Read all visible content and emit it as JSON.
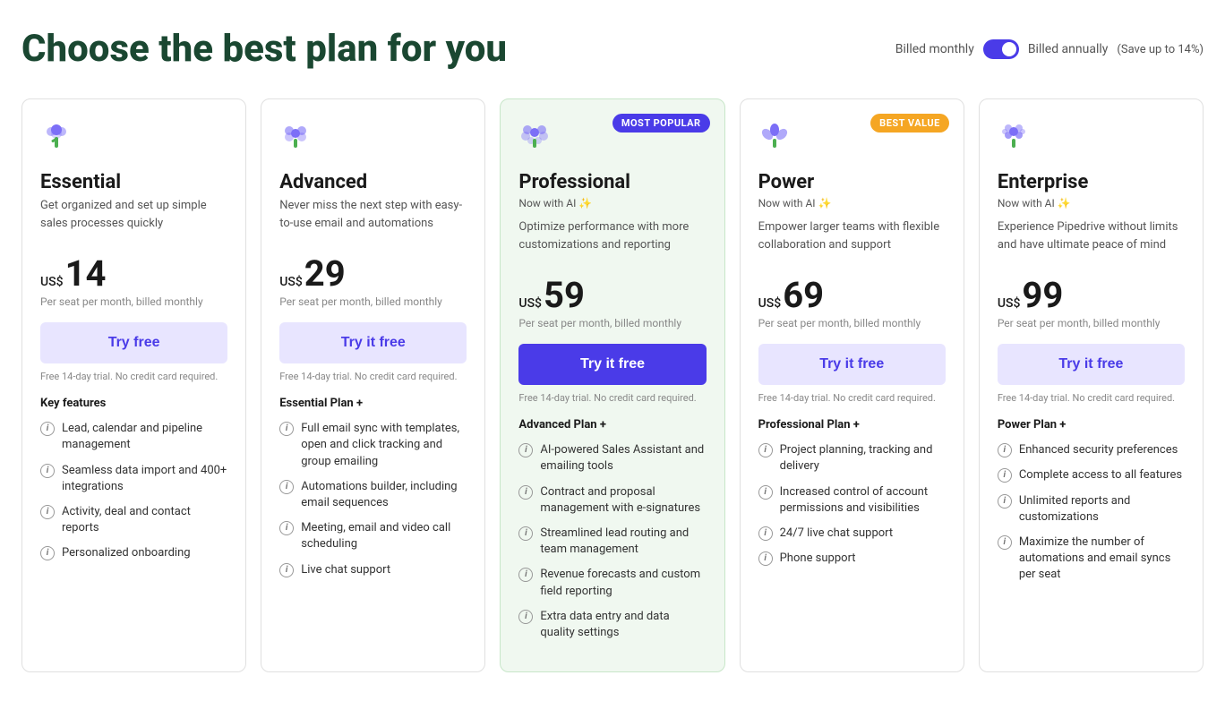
{
  "header": {
    "title": "Choose the best plan for you",
    "billing": {
      "monthly_label": "Billed monthly",
      "annually_label": "Billed annually",
      "save_label": "(Save up to 14%)",
      "toggle_state": "annually"
    }
  },
  "plans": [
    {
      "id": "essential",
      "name": "Essential",
      "badge": null,
      "highlighted": false,
      "ai": false,
      "description": "Get organized and set up simple sales processes quickly",
      "currency": "US$",
      "price": "14",
      "period": "Per seat per month, billed monthly",
      "btn_label": "Try free",
      "btn_style": "default",
      "trial_note": "Free 14-day trial. No credit card required.",
      "features_title": "Key features",
      "features": [
        "Lead, calendar and pipeline management",
        "Seamless data import and 400+ integrations",
        "Activity, deal and contact reports",
        "Personalized onboarding"
      ]
    },
    {
      "id": "advanced",
      "name": "Advanced",
      "badge": null,
      "highlighted": false,
      "ai": false,
      "description": "Never miss the next step with easy-to-use email and automations",
      "currency": "US$",
      "price": "29",
      "period": "Per seat per month, billed monthly",
      "btn_label": "Try it free",
      "btn_style": "default",
      "trial_note": "Free 14-day trial. No credit card required.",
      "features_title": "Essential Plan +",
      "features": [
        "Full email sync with templates, open and click tracking and group emailing",
        "Automations builder, including email sequences",
        "Meeting, email and video call scheduling",
        "Live chat support"
      ]
    },
    {
      "id": "professional",
      "name": "Professional",
      "badge": "MOST POPULAR",
      "badge_style": "popular",
      "highlighted": true,
      "ai": true,
      "ai_label": "Now with AI ✨",
      "description": "Optimize performance with more customizations and reporting",
      "currency": "US$",
      "price": "59",
      "period": "Per seat per month, billed monthly",
      "btn_label": "Try it free",
      "btn_style": "primary",
      "trial_note": "Free 14-day trial. No credit card required.",
      "features_title": "Advanced Plan +",
      "features": [
        "AI-powered Sales Assistant and emailing tools",
        "Contract and proposal management with e-signatures",
        "Streamlined lead routing and team management",
        "Revenue forecasts and custom field reporting",
        "Extra data entry and data quality settings"
      ]
    },
    {
      "id": "power",
      "name": "Power",
      "badge": "BEST VALUE",
      "badge_style": "value",
      "highlighted": false,
      "ai": true,
      "ai_label": "Now with AI ✨",
      "description": "Empower larger teams with flexible collaboration and support",
      "currency": "US$",
      "price": "69",
      "period": "Per seat per month, billed monthly",
      "btn_label": "Try it free",
      "btn_style": "default",
      "trial_note": "Free 14-day trial. No credit card required.",
      "features_title": "Professional Plan +",
      "features": [
        "Project planning, tracking and delivery",
        "Increased control of account permissions and visibilities",
        "24/7 live chat support",
        "Phone support"
      ]
    },
    {
      "id": "enterprise",
      "name": "Enterprise",
      "badge": null,
      "highlighted": false,
      "ai": true,
      "ai_label": "Now with AI ✨",
      "description": "Experience Pipedrive without limits and have ultimate peace of mind",
      "currency": "US$",
      "price": "99",
      "period": "Per seat per month, billed monthly",
      "btn_label": "Try it free",
      "btn_style": "default",
      "trial_note": "Free 14-day trial. No credit card required.",
      "features_title": "Power Plan +",
      "features": [
        "Enhanced security preferences",
        "Complete access to all features",
        "Unlimited reports and customizations",
        "Maximize the number of automations and email syncs per seat"
      ]
    }
  ],
  "icons": {
    "essential": "🌱",
    "advanced": "🌸",
    "professional": "🌺",
    "power": "🌷",
    "enterprise": "💐"
  }
}
